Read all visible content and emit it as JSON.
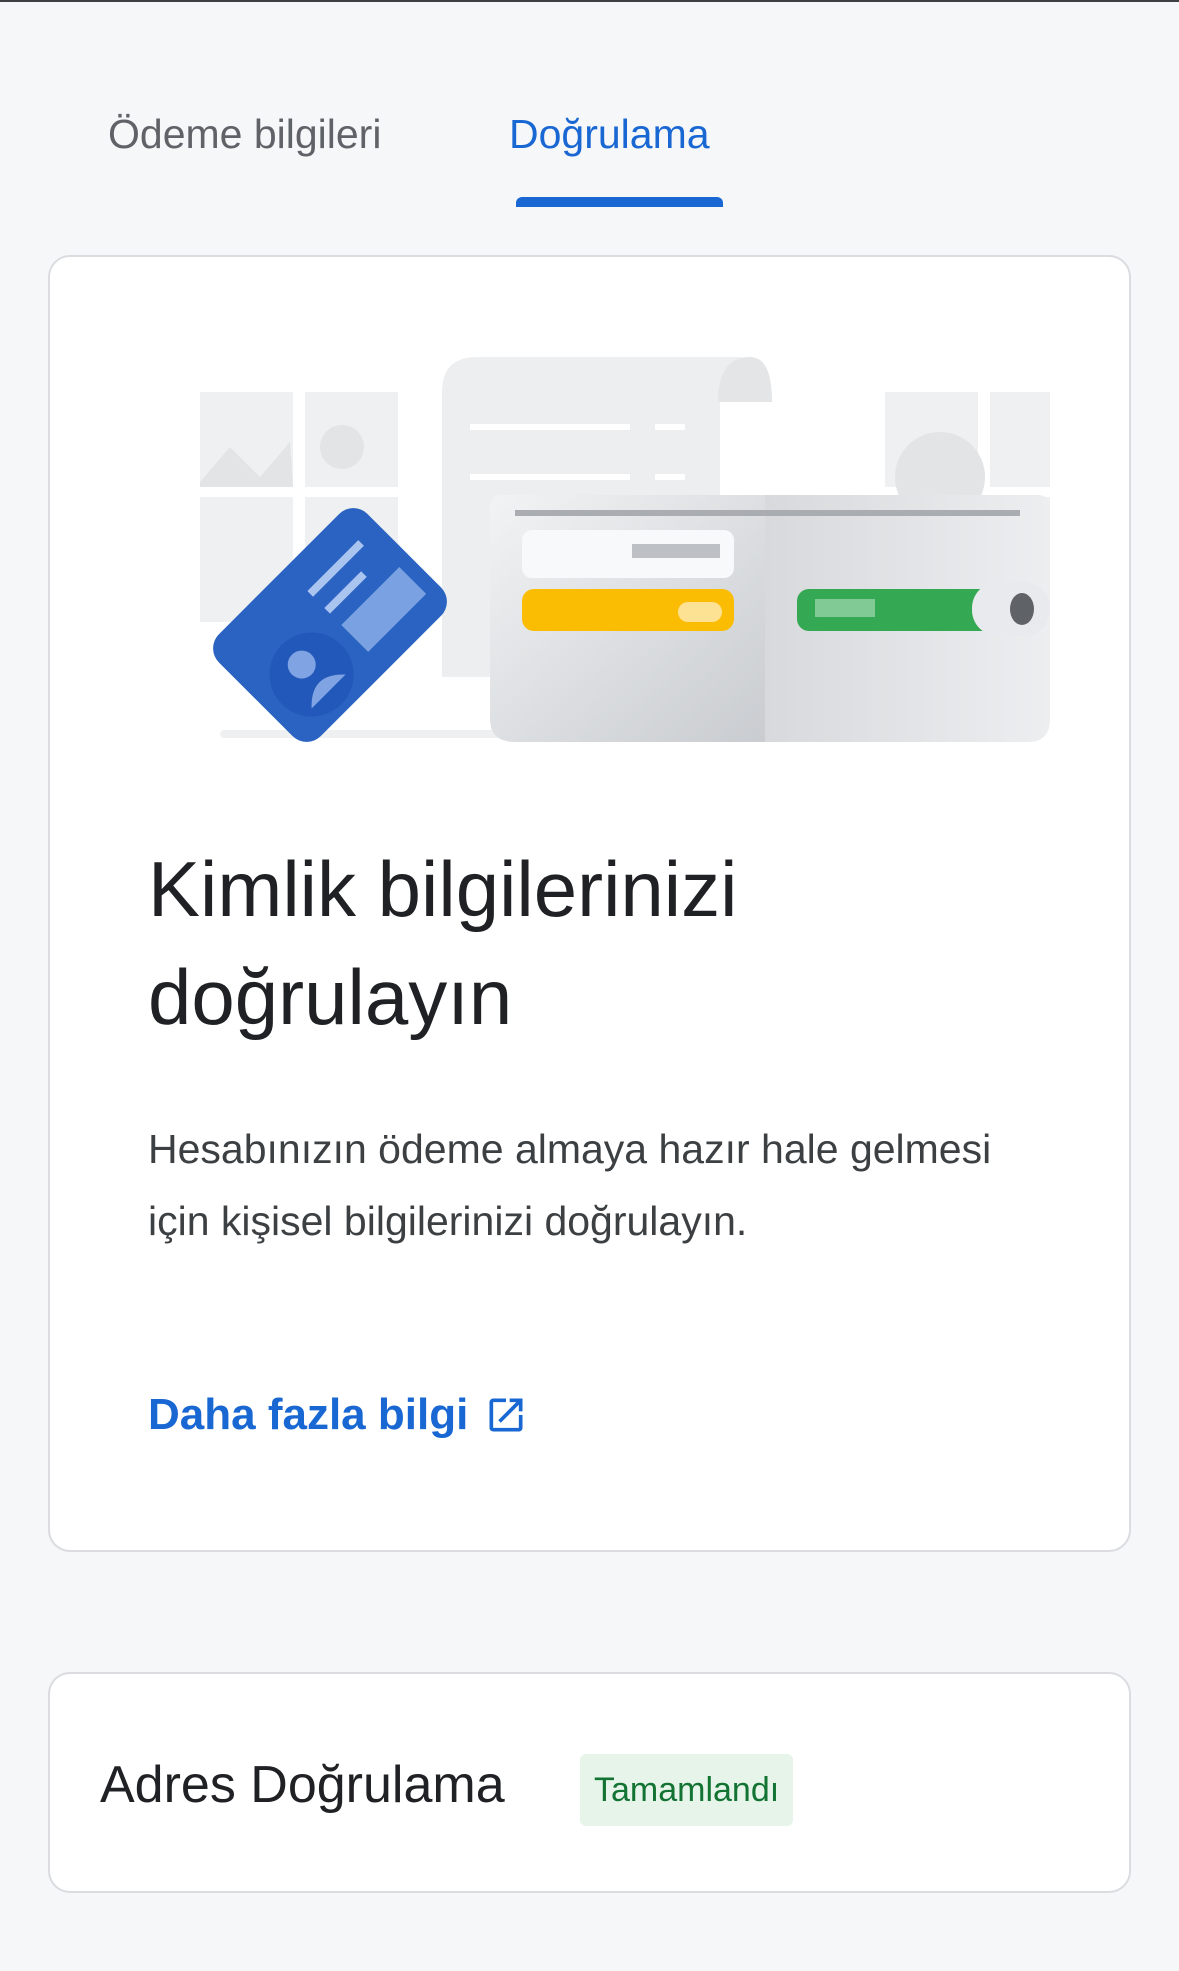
{
  "tabs": [
    {
      "label": "Ödeme bilgileri",
      "active": false
    },
    {
      "label": "Doğrulama",
      "active": true
    }
  ],
  "identity_card": {
    "illustration": "wallet-with-id-card-illustration",
    "title": "Kimlik bilgilerinizi doğrulayın",
    "description": "Hesabınızın ödeme almaya hazır hale gelmesi için kişisel bilgilerinizi doğrulayın.",
    "link_label": "Daha fazla bilgi",
    "link_icon": "open-in-new-icon"
  },
  "address_card": {
    "title": "Adres Doğrulama",
    "status": "Tamamlandı"
  },
  "colors": {
    "accent": "#1967d2",
    "background": "#f6f7f9",
    "status_text": "#137333",
    "status_bg": "#e6f4ea"
  }
}
